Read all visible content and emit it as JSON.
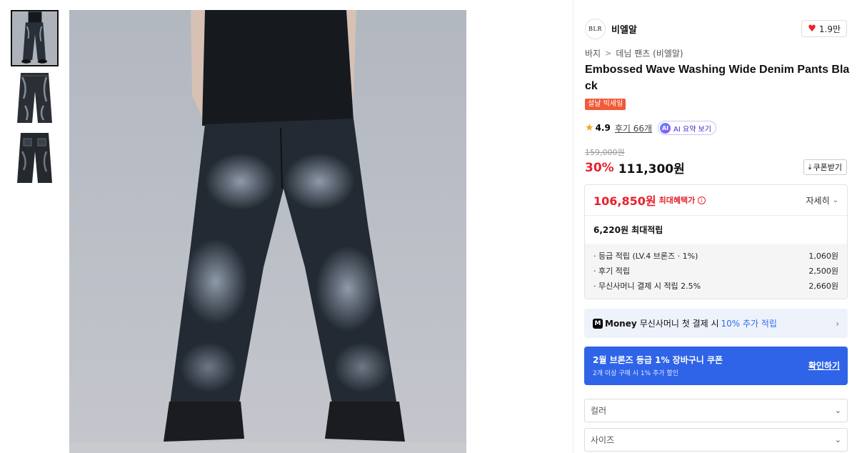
{
  "gallery": {
    "thumbnails": [
      {
        "alt": "model-wearing-jeans"
      },
      {
        "alt": "jeans-front"
      },
      {
        "alt": "jeans-back"
      }
    ]
  },
  "brand": {
    "logo_text": "BLR",
    "name": "비엘알",
    "likes": "1.9만"
  },
  "breadcrumb": [
    "바지",
    "데님 팬츠 (비엘알)"
  ],
  "product": {
    "title": "Embossed Wave Washing Wide Denim Pants Black",
    "sale_tag": "설날 빅세일",
    "rating": "4.9",
    "reviews": "후기 66개",
    "ai_label": "AI 요약 보기",
    "ai_badge": "AI",
    "original_price": "159,000원",
    "discount": "30%",
    "price": "111,300원",
    "coupon_button": "쿠폰받기"
  },
  "benefits": {
    "max_price": "106,850원",
    "max_label": "최대혜택가",
    "detail_label": "자세히",
    "points_title": "6,220원 최대적립",
    "points": [
      {
        "label": "· 등급 적립 (LV.4 브론즈 · 1%)",
        "value": "1,060원"
      },
      {
        "label": "· 후기 적립",
        "value": "2,500원"
      },
      {
        "label": "· 무신사머니 결제 시 적립 2.5%",
        "value": "2,660원"
      }
    ]
  },
  "money_banner": {
    "logo": "M",
    "brand_word": "Money",
    "text": "무신사머니 첫 결제 시",
    "accent": "10% 추가 적립"
  },
  "coupon_banner": {
    "title": "2월 브론즈 등급 1% 장바구니 쿠폰",
    "subtitle": "2개 이상 구매 시 1% 추가 할인",
    "link": "확인하기"
  },
  "options": {
    "color_placeholder": "컬러",
    "size_placeholder": "사이즈"
  },
  "colors": {
    "accent_red": "#e6222c",
    "accent_blue": "#2f64e9",
    "sale_tag": "#f25a38"
  }
}
